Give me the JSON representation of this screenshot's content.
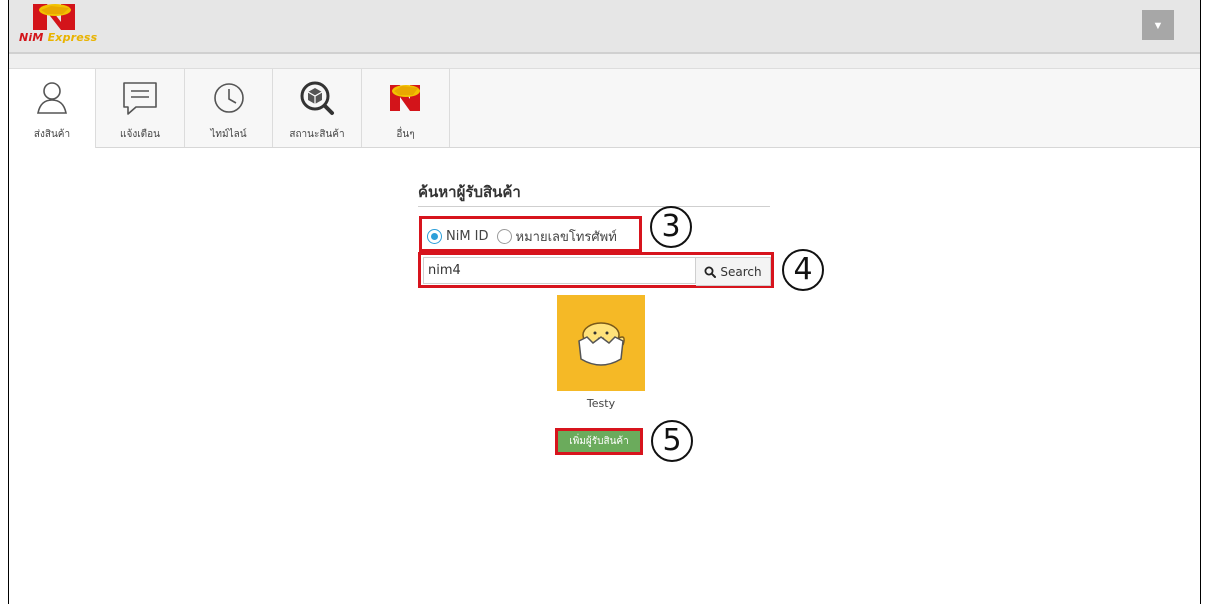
{
  "header": {
    "brand_main": "NiM",
    "brand_suffix": "Express",
    "dropdown_icon": "caret-down-icon"
  },
  "nav": {
    "tabs": [
      {
        "label": "ส่งสินค้า",
        "icon": "user-icon",
        "active": true
      },
      {
        "label": "แจ้งเตือน",
        "icon": "message-icon",
        "active": false
      },
      {
        "label": "ไทม์ไลน์",
        "icon": "clock-icon",
        "active": false
      },
      {
        "label": "สถานะสินค้า",
        "icon": "box-search-icon",
        "active": false
      },
      {
        "label": "อื่นๆ",
        "icon": "nim-logo-icon",
        "active": false
      }
    ]
  },
  "search_panel": {
    "title": "ค้นหาผู้รับสินค้า",
    "radio_options": [
      {
        "label": "NiM ID",
        "selected": true
      },
      {
        "label": "หมายเลขโทรศัพท์",
        "selected": false
      }
    ],
    "search_value": "nim4",
    "search_button": "Search",
    "result": {
      "name": "Testy",
      "avatar": "egg-chick-avatar"
    },
    "add_button": "เพิ่มผู้รับสินค้า"
  },
  "annotations": {
    "step3": "3",
    "step4": "4",
    "step5": "5"
  },
  "colors": {
    "accent_blue": "#2d9fd9",
    "highlight_red": "#d7141d",
    "add_green": "#6bab5c",
    "avatar_bg": "#f5b926"
  }
}
